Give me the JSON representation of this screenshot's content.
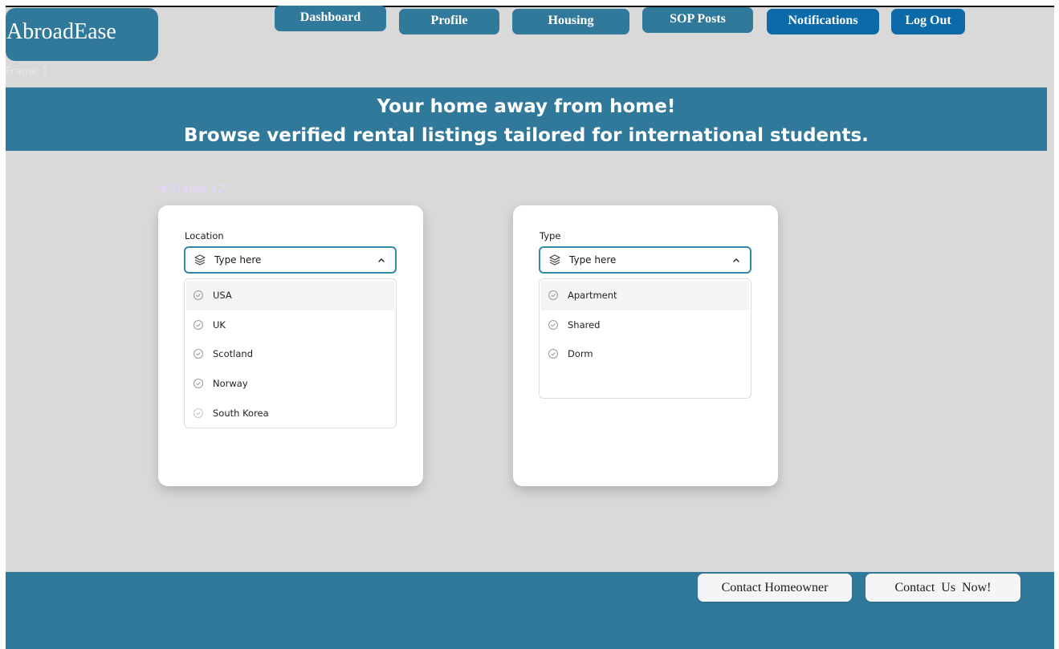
{
  "brand": {
    "name": "AbroadEase"
  },
  "frame_label": "Frame 1",
  "frame12_label": "Frame 12",
  "nav": {
    "dashboard": "Dashboard",
    "profile": "Profile",
    "housing": "Housing",
    "sop_posts": "SOP Posts",
    "notifications": "Notifications",
    "logout": "Log Out"
  },
  "banner": {
    "line1": "Your home away from home!",
    "line2": "Browse verified rental listings tailored for international students."
  },
  "location_filter": {
    "label": "Location",
    "placeholder": "Type here",
    "options": [
      "USA",
      "UK",
      "Scotland",
      "Norway",
      "South Korea"
    ]
  },
  "type_filter": {
    "label": "Type",
    "placeholder": "Type here",
    "options": [
      "Apartment",
      "Shared",
      "Dorm"
    ]
  },
  "footer": {
    "contact_homeowner": "Contact Homeowner",
    "contact_us": "Contact  Us  Now!"
  },
  "icons": {
    "layers": "layers-icon",
    "chevron": "chevron-up-icon",
    "check": "check-circle-icon"
  },
  "colors": {
    "primary": "#31799b",
    "nav_active": "#0c6aa8",
    "background": "#d9d9d9",
    "select_border": "#2f8aa8"
  }
}
